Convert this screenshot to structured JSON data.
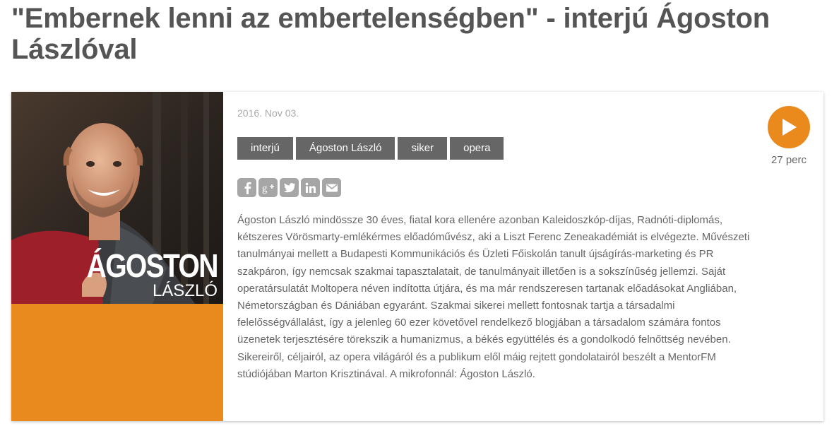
{
  "page": {
    "title": "\"Embernek lenni az embertelenségben\" - interjú Ágoston Lászlóval"
  },
  "cover": {
    "first_name": "ÁGOSTON",
    "last_name": "LÁSZLÓ",
    "accent_color": "#e98a1e"
  },
  "episode": {
    "date": "2016. Nov 03.",
    "tags": [
      {
        "label": "interjú"
      },
      {
        "label": "Ágoston László"
      },
      {
        "label": "siker"
      },
      {
        "label": "opera"
      }
    ],
    "share_icons": [
      "facebook-icon",
      "google-plus-icon",
      "twitter-icon",
      "linkedin-icon",
      "email-icon"
    ],
    "description": "Ágoston László mindössze 30 éves, fiatal kora ellenére azonban Kaleidoszkóp-díjas, Radnóti-diplomás, kétszeres Vörösmarty-emlékérmes előadóművész, aki a Liszt Ferenc Zeneakadémiát is elvégezte. Művészeti tanulmányai mellett a Budapesti Kommunikációs és Üzleti Főiskolán tanult újságírás-marketing és PR szakpáron, így nemcsak szakmai tapasztalatait, de tanulmányait illetően is a sokszínűség jellemzi. Saját operatársulatát Moltopera néven indította útjára, és ma már rendszeresen tartanak előadásokat Angliában, Németországban és Dániában egyaránt. Szakmai sikerei mellett fontosnak tartja a társadalmi felelősségvállalást, így a jelenleg 60 ezer követővel rendelkező blogjában a társadalom számára fontos üzenetek terjesztésére törekszik a humanizmus, a békés együttélés és a gondolkodó felnőttség nevében. Sikereiről, céljairól, az opera világáról és a publikum elől máig rejtett gondolatairól beszélt a MentorFM stúdiójában Marton Krisztinával. A mikrofonnál: Ágoston László."
  },
  "player": {
    "duration": "27 perc",
    "button_color": "#ea8a1d"
  }
}
